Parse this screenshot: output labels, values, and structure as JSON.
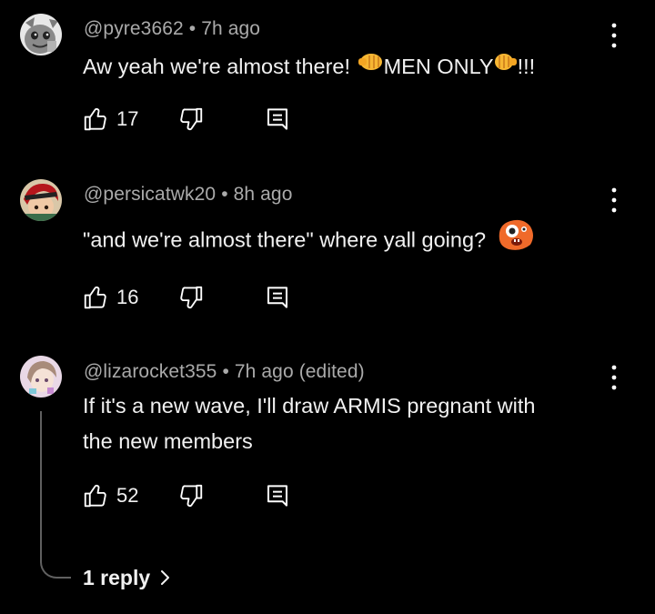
{
  "comments": [
    {
      "handle": "@pyre3662",
      "time": "7h ago",
      "text_before": "Aw yeah we're almost there! ",
      "text_mid": "MEN ONLY",
      "text_after": "!!!",
      "likes": "17",
      "avatar_icon": "gray-cartoon-cat-avatar",
      "emoji_icons": [
        "left-fist-emoji",
        "right-fist-emoji"
      ]
    },
    {
      "handle": "@persicatwk20",
      "time": "8h ago",
      "text": "\"and we're almost there\" where yall going?",
      "likes": "16",
      "avatar_icon": "red-hair-anime-avatar",
      "emoji_icons": [
        "orange-shocked-face-emoji"
      ]
    },
    {
      "handle": "@lizarocket355",
      "time": "7h ago",
      "edited": "(edited)",
      "text_line1": "If it's a new wave, I'll draw ARMIS pregnant with",
      "text_line2": "the new members",
      "likes": "52",
      "avatar_icon": "pastel-drawing-avatar"
    }
  ],
  "thread": {
    "reply_label": "1 reply"
  },
  "colors": {
    "background": "#000000",
    "primary_text": "#f1f1f1",
    "secondary_text": "#aaaaaa",
    "thread_line": "#606060"
  },
  "icons": {
    "like": "thumb-up-icon",
    "dislike": "thumb-down-icon",
    "reply": "comment-reply-icon",
    "menu": "more-vertical-icon",
    "expand": "chevron-right-icon"
  }
}
